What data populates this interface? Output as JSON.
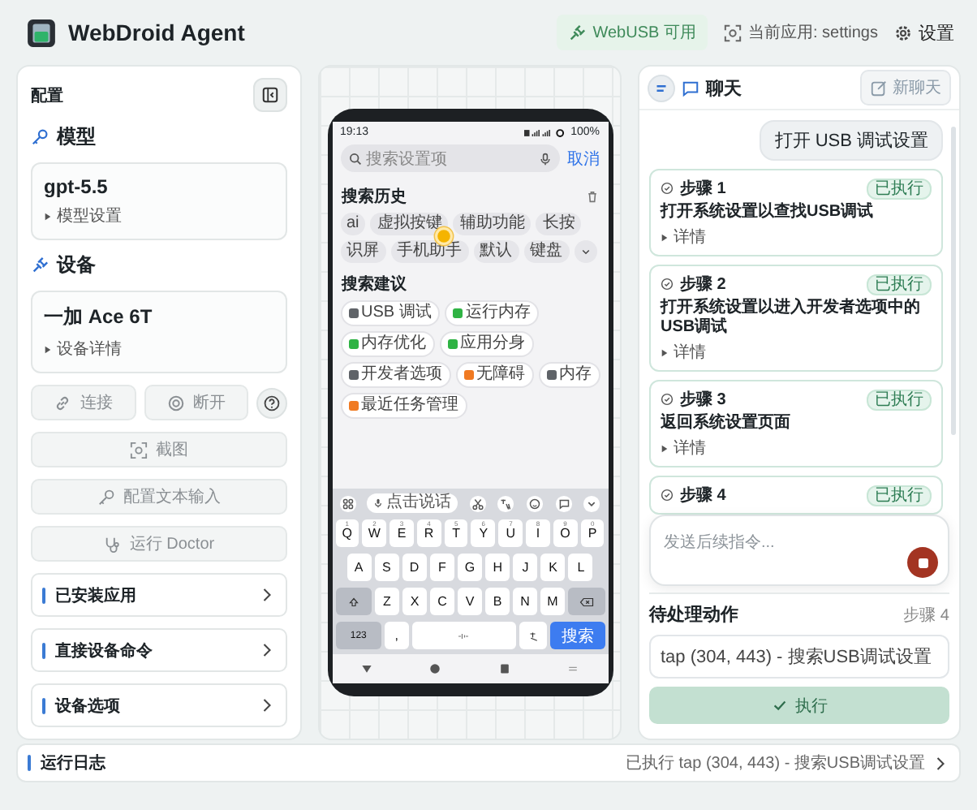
{
  "header": {
    "title": "WebDroid Agent",
    "usb_status": "WebUSB 可用",
    "current_app": "当前应用: settings",
    "settings": "设置"
  },
  "config": {
    "title": "配置",
    "model": {
      "heading": "模型",
      "name": "gpt-5.5",
      "details": "模型设置"
    },
    "device": {
      "heading": "设备",
      "name": "一加 Ace 6T",
      "details": "设备详情"
    },
    "actions": [
      {
        "kind": "connect",
        "label": "连接",
        "disabled": true
      },
      {
        "kind": "disconnect",
        "label": "断开",
        "disabled": true
      },
      {
        "kind": "screenshot",
        "label": "截图",
        "disabled": true
      },
      {
        "kind": "text-input",
        "label": "配置文本输入",
        "disabled": true
      },
      {
        "kind": "doctor",
        "label": "运行 Doctor",
        "disabled": true
      }
    ],
    "sections": [
      {
        "label": "已安装应用",
        "expanded": false
      },
      {
        "label": "直接设备命令",
        "expanded": false
      },
      {
        "label": "设备选项",
        "expanded": false
      }
    ]
  },
  "phone": {
    "time": "19:13",
    "battery": "100%",
    "search": {
      "placeholder": "搜索设置项"
    },
    "cancel": "取消",
    "history": {
      "title": "搜索历史",
      "chips": [
        "ai",
        "虚拟按键",
        "辅助功能",
        "长按",
        "识屏",
        "手机助手",
        "默认",
        "键盘"
      ]
    },
    "suggestions": {
      "title": "搜索建议",
      "chips": [
        {
          "label": "USB 调试",
          "color": "#5f6368"
        },
        {
          "label": "运行内存",
          "color": "#2fb344"
        },
        {
          "label": "内存优化",
          "color": "#2fb344"
        },
        {
          "label": "应用分身",
          "color": "#2fb344"
        },
        {
          "label": "开发者选项",
          "color": "#5f6368"
        },
        {
          "label": "无障碍",
          "color": "#f07a22"
        },
        {
          "label": "内存",
          "color": "#5f6368"
        },
        {
          "label": "最近任务管理",
          "color": "#f07a22"
        }
      ]
    },
    "keyboard": {
      "voice": "点击说话",
      "hints": [
        "1",
        "2",
        "3",
        "4",
        "5",
        "6",
        "7",
        "8",
        "9",
        "0"
      ],
      "rows": [
        [
          "Q",
          "W",
          "E",
          "R",
          "T",
          "Y",
          "U",
          "I",
          "O",
          "P"
        ],
        [
          "A",
          "S",
          "D",
          "F",
          "G",
          "H",
          "J",
          "K",
          "L"
        ],
        [
          "Z",
          "X",
          "C",
          "V",
          "B",
          "N",
          "M"
        ]
      ],
      "numbers_key": "123",
      "comma": ",",
      "search_key": "搜索"
    }
  },
  "chat": {
    "title": "聊天",
    "new_chat": "新聊天",
    "messages": [
      {
        "kind": "user",
        "text": "打开 USB 调试设置"
      },
      {
        "kind": "step",
        "title": "步骤 1",
        "status": "已执行",
        "text": "打开系统设置以查找USB调试",
        "details": "详情"
      },
      {
        "kind": "step",
        "title": "步骤 2",
        "status": "已执行",
        "text": "打开系统设置以进入开发者选项中的USB调试",
        "details": "详情"
      },
      {
        "kind": "step",
        "title": "步骤 3",
        "status": "已执行",
        "text": "返回系统设置页面",
        "details": "详情"
      },
      {
        "kind": "step",
        "title": "步骤 4",
        "status": "已执行"
      }
    ],
    "composer": {
      "placeholder": "发送后续指令..."
    },
    "pending": {
      "title": "待处理动作",
      "step": "步骤 4",
      "action": "tap (304, 443) - 搜索USB调试设置",
      "execute": "执行",
      "disabled": true
    }
  },
  "log": {
    "title": "运行日志",
    "last": "已执行 tap (304, 443) - 搜索USB调试设置"
  }
}
